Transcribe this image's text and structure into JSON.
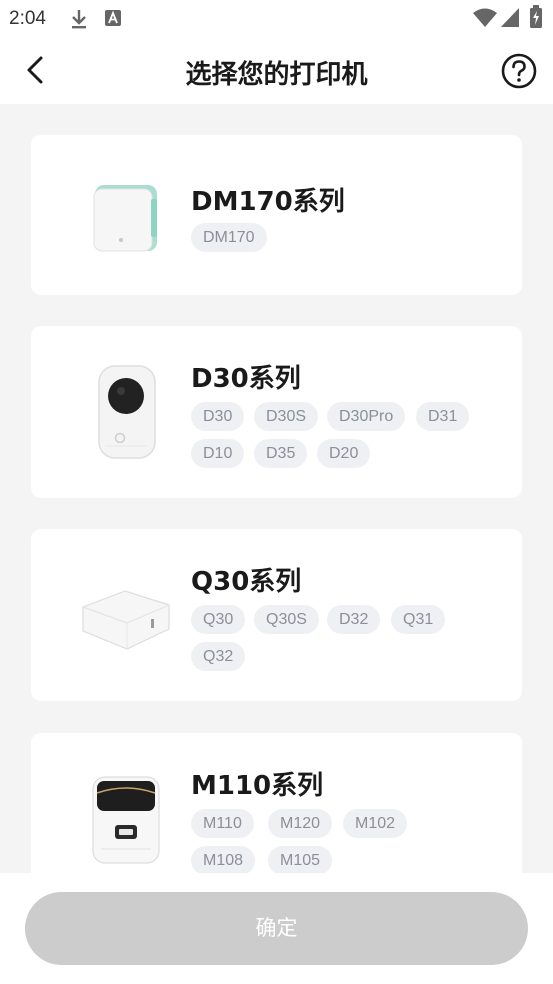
{
  "status_bar": {
    "time": "2:04",
    "icons": [
      "download-icon",
      "font-app-icon",
      "wifi-icon",
      "signal-icon",
      "battery-icon"
    ]
  },
  "header": {
    "title": "选择您的打印机",
    "back_icon": "chevron-left-icon",
    "help_icon": "question-circle-icon"
  },
  "series": [
    {
      "title": "DM170系列",
      "image": "mint-label-printer",
      "models": [
        "DM170"
      ]
    },
    {
      "title": "D30系列",
      "image": "white-handheld-printer",
      "models": [
        "D30",
        "D30S",
        "D30Pro",
        "D31",
        "D10",
        "D35",
        "D20"
      ]
    },
    {
      "title": "Q30系列",
      "image": "white-square-printer",
      "models": [
        "Q30",
        "Q30S",
        "D32",
        "Q31",
        "Q32"
      ]
    },
    {
      "title": "M110系列",
      "image": "white-thermal-printer",
      "models": [
        "M110",
        "M120",
        "M102",
        "M108",
        "M105"
      ]
    }
  ],
  "footer": {
    "confirm_label": "确定"
  },
  "colors": {
    "chip_bg": "#eef0f3",
    "chip_text": "#8a8f99",
    "button_disabled": "#cccccc",
    "page_bg": "#f4f4f5"
  }
}
